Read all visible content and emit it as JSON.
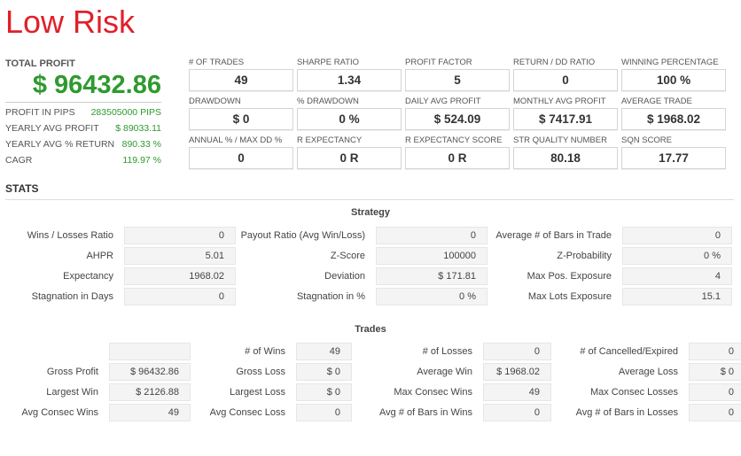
{
  "title": "Low Risk",
  "total_profit": {
    "label": "TOTAL PROFIT",
    "value": "$ 96432.86",
    "rows": [
      {
        "label": "PROFIT IN PIPS",
        "value": "283505000 PIPS"
      },
      {
        "label": "YEARLY AVG PROFIT",
        "value": "$ 89033.11"
      },
      {
        "label": "YEARLY AVG % RETURN",
        "value": "890.33 %"
      },
      {
        "label": "CAGR",
        "value": "119.97 %"
      }
    ]
  },
  "kpis": [
    {
      "label": "# OF TRADES",
      "value": "49"
    },
    {
      "label": "SHARPE RATIO",
      "value": "1.34"
    },
    {
      "label": "PROFIT FACTOR",
      "value": "5"
    },
    {
      "label": "RETURN / DD RATIO",
      "value": "0"
    },
    {
      "label": "WINNING PERCENTAGE",
      "value": "100 %"
    },
    {
      "label": "DRAWDOWN",
      "value": "$ 0"
    },
    {
      "label": "% DRAWDOWN",
      "value": "0 %"
    },
    {
      "label": "DAILY AVG PROFIT",
      "value": "$ 524.09"
    },
    {
      "label": "MONTHLY AVG PROFIT",
      "value": "$ 7417.91"
    },
    {
      "label": "AVERAGE TRADE",
      "value": "$ 1968.02"
    },
    {
      "label": "ANNUAL % / MAX DD %",
      "value": "0"
    },
    {
      "label": "R EXPECTANCY",
      "value": "0 R"
    },
    {
      "label": "R EXPECTANCY SCORE",
      "value": "0 R"
    },
    {
      "label": "STR QUALITY NUMBER",
      "value": "80.18"
    },
    {
      "label": "SQN SCORE",
      "value": "17.77"
    }
  ],
  "stats": {
    "heading": "STATS",
    "strategy": {
      "title": "Strategy",
      "rows": [
        [
          {
            "label": "Wins / Losses Ratio",
            "value": "0"
          },
          {
            "label": "Payout Ratio (Avg Win/Loss)",
            "value": "0"
          },
          {
            "label": "Average # of Bars in Trade",
            "value": "0"
          }
        ],
        [
          {
            "label": "AHPR",
            "value": "5.01"
          },
          {
            "label": "Z-Score",
            "value": "100000"
          },
          {
            "label": "Z-Probability",
            "value": "0 %"
          }
        ],
        [
          {
            "label": "Expectancy",
            "value": "1968.02"
          },
          {
            "label": "Deviation",
            "value": "$ 171.81"
          },
          {
            "label": "Max Pos. Exposure",
            "value": "4"
          }
        ],
        [
          {
            "label": "Stagnation in Days",
            "value": "0"
          },
          {
            "label": "Stagnation in %",
            "value": "0 %"
          },
          {
            "label": "Max Lots Exposure",
            "value": "15.1"
          }
        ]
      ]
    },
    "trades": {
      "title": "Trades",
      "rows": [
        [
          {
            "label": "",
            "value": ""
          },
          {
            "label": "# of Wins",
            "value": "49"
          },
          {
            "label": "# of Losses",
            "value": "0"
          },
          {
            "label": "# of Cancelled/Expired",
            "value": "0"
          }
        ],
        [
          {
            "label": "Gross Profit",
            "value": "$ 96432.86"
          },
          {
            "label": "Gross Loss",
            "value": "$ 0"
          },
          {
            "label": "Average Win",
            "value": "$ 1968.02"
          },
          {
            "label": "Average Loss",
            "value": "$ 0"
          }
        ],
        [
          {
            "label": "Largest Win",
            "value": "$ 2126.88"
          },
          {
            "label": "Largest Loss",
            "value": "$ 0"
          },
          {
            "label": "Max Consec Wins",
            "value": "49"
          },
          {
            "label": "Max Consec Losses",
            "value": "0"
          }
        ],
        [
          {
            "label": "Avg Consec Wins",
            "value": "49"
          },
          {
            "label": "Avg Consec Loss",
            "value": "0"
          },
          {
            "label": "Avg # of Bars in Wins",
            "value": "0"
          },
          {
            "label": "Avg # of Bars in Losses",
            "value": "0"
          }
        ]
      ]
    }
  }
}
